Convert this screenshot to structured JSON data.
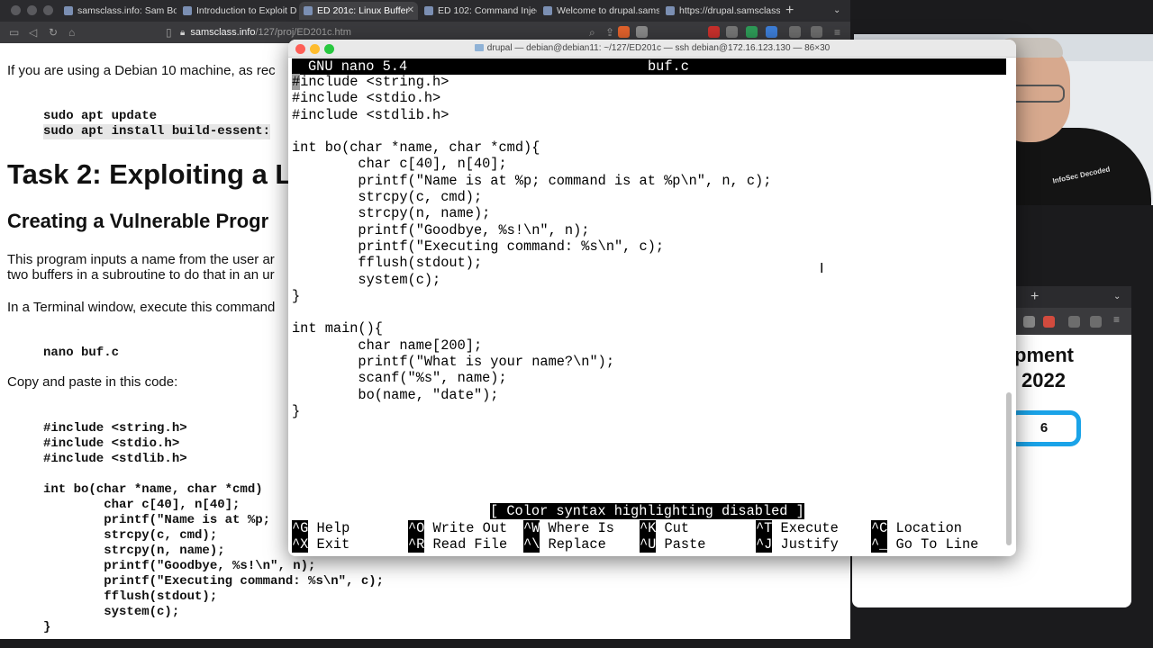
{
  "browser": {
    "tabs": [
      {
        "label": "samsclass.info: Sam Bown"
      },
      {
        "label": "Introduction to Exploit Dev"
      },
      {
        "label": "ED 201c: Linux Buffer"
      },
      {
        "label": "ED 102: Command Injecti"
      },
      {
        "label": "Welcome to drupal.samscl"
      },
      {
        "label": "https://drupal.samsclass.i"
      }
    ],
    "new_tab": "+",
    "url_host": "samsclass.info",
    "url_path": "/127/proj/ED201c.htm"
  },
  "page": {
    "intro": "If you are using a Debian 10 machine, as rec",
    "cmd1": "sudo apt update",
    "cmd2": "sudo apt install build-essent:",
    "task_heading": "Task 2: Exploiting a L",
    "sub_heading": "Creating a Vulnerable Progr",
    "para1a": "This program inputs a name from the user ar",
    "para1b": "two buffers in a subroutine to do that in an ur",
    "para2": "In a Terminal window, execute this command",
    "nano_cmd": "nano buf.c",
    "para3": "Copy and paste in this code:",
    "code": [
      "#include <string.h>",
      "#include <stdio.h>",
      "#include <stdlib.h>",
      "",
      "int bo(char *name, char *cmd)",
      "        char c[40], n[40];",
      "        printf(\"Name is at %p;",
      "        strcpy(c, cmd);",
      "        strcpy(n, name);",
      "        printf(\"Goodbye, %s!\\n\", n);",
      "        printf(\"Executing command: %s\\n\", c);",
      "        fflush(stdout);",
      "        system(c);",
      "}"
    ]
  },
  "browser2": {
    "new_tab": "+",
    "heading1": "pment",
    "heading2": "2022",
    "badge": "6"
  },
  "cam": {
    "logo": "InfoSec Decoded"
  },
  "terminal": {
    "title": "drupal — debian@debian11: ~/127/ED201c — ssh debian@172.16.123.130 — 86×30",
    "nano_version": "GNU nano 5.4",
    "filename": "buf.c",
    "first_char": "#",
    "lines": [
      "include <string.h>",
      "#include <stdio.h>",
      "#include <stdlib.h>",
      "",
      "int bo(char *name, char *cmd){",
      "        char c[40], n[40];",
      "        printf(\"Name is at %p; command is at %p\\n\", n, c);",
      "        strcpy(c, cmd);",
      "        strcpy(n, name);",
      "        printf(\"Goodbye, %s!\\n\", n);",
      "        printf(\"Executing command: %s\\n\", c);",
      "        fflush(stdout);",
      "        system(c);",
      "}",
      "",
      "int main(){",
      "        char name[200];",
      "        printf(\"What is your name?\\n\");",
      "        scanf(\"%s\", name);",
      "        bo(name, \"date\");",
      "}"
    ],
    "status": "[ Color syntax highlighting disabled ]",
    "help_row1": [
      {
        "key": "^G",
        "label": "Help"
      },
      {
        "key": "^O",
        "label": "Write Out"
      },
      {
        "key": "^W",
        "label": "Where Is"
      },
      {
        "key": "^K",
        "label": "Cut"
      },
      {
        "key": "^T",
        "label": "Execute"
      },
      {
        "key": "^C",
        "label": "Location"
      }
    ],
    "help_row2": [
      {
        "key": "^X",
        "label": "Exit"
      },
      {
        "key": "^R",
        "label": "Read File"
      },
      {
        "key": "^\\",
        "label": "Replace"
      },
      {
        "key": "^U",
        "label": "Paste"
      },
      {
        "key": "^J",
        "label": "Justify"
      },
      {
        "key": "^_",
        "label": "Go To Line"
      }
    ]
  }
}
